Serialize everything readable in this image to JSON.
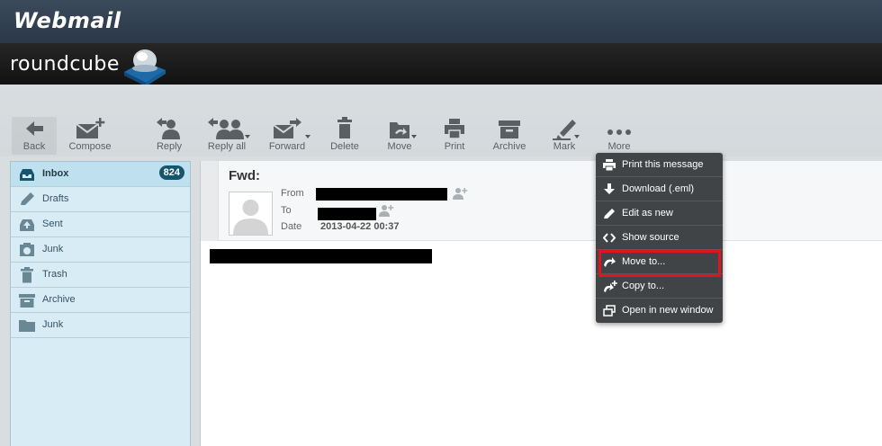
{
  "header": {
    "title": "Webmail",
    "brand": "roundcube"
  },
  "toolbar": {
    "back": "Back",
    "compose": "Compose",
    "reply": "Reply",
    "reply_all": "Reply all",
    "forward": "Forward",
    "delete": "Delete",
    "move": "Move",
    "print": "Print",
    "archive": "Archive",
    "mark": "Mark",
    "more": "More"
  },
  "folders": [
    {
      "name": "Inbox",
      "icon": "inbox-icon",
      "count": "824"
    },
    {
      "name": "Drafts",
      "icon": "pencil-icon"
    },
    {
      "name": "Sent",
      "icon": "sent-icon"
    },
    {
      "name": "Junk",
      "icon": "junk-icon"
    },
    {
      "name": "Trash",
      "icon": "trash-icon"
    },
    {
      "name": "Archive",
      "icon": "archive-icon"
    },
    {
      "name": "Junk",
      "icon": "folder-icon"
    }
  ],
  "message": {
    "subject": "Fwd:",
    "from_label": "From",
    "to_label": "To",
    "date_label": "Date",
    "date": "2013-04-22 00:37"
  },
  "more_menu": [
    {
      "label": "Print this message",
      "icon": "print-icon"
    },
    {
      "label": "Download (.eml)",
      "icon": "download-icon"
    },
    {
      "label": "Edit as new",
      "icon": "edit-icon"
    },
    {
      "label": "Show source",
      "icon": "code-icon"
    },
    {
      "label": "Move to...",
      "icon": "move-icon"
    },
    {
      "label": "Copy to...",
      "icon": "copy-icon"
    },
    {
      "label": "Open in new window",
      "icon": "new-window-icon"
    }
  ],
  "colors": {
    "accent": "#15566e",
    "folder_bg": "#d8ecf5",
    "menu_bg": "#404447",
    "highlight": "#e0141e"
  }
}
